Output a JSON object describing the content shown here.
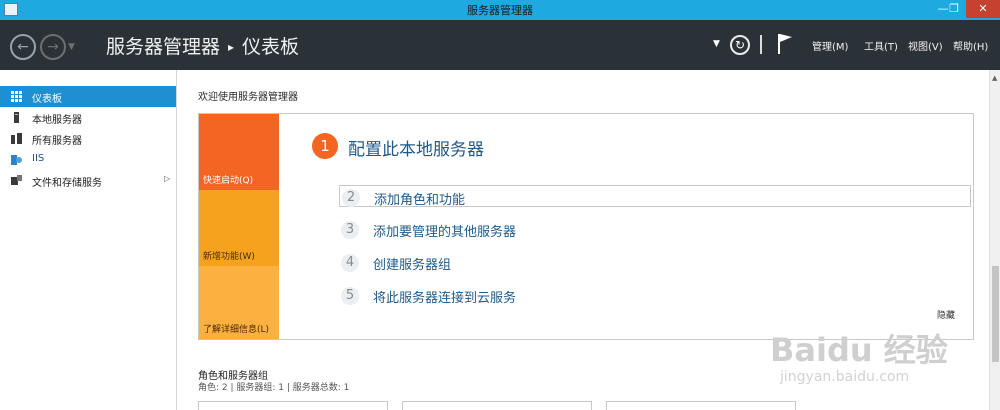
{
  "window": {
    "title": "服务器管理器",
    "controls": {
      "minimize": "—",
      "maximize": "❐",
      "close": "✕"
    }
  },
  "header": {
    "breadcrumb": [
      "服务器管理器",
      "仪表板"
    ],
    "separator": "▸",
    "menus": [
      "管理(M)",
      "工具(T)",
      "视图(V)",
      "帮助(H)"
    ]
  },
  "sidebar": {
    "items": [
      {
        "label": "仪表板",
        "icon": "dashboard-grid-icon",
        "active": true
      },
      {
        "label": "本地服务器",
        "icon": "server-icon"
      },
      {
        "label": "所有服务器",
        "icon": "servers-icon"
      },
      {
        "label": "IIS",
        "icon": "iis-icon"
      },
      {
        "label": "文件和存储服务",
        "icon": "file-storage-icon",
        "has_arrow": true
      }
    ]
  },
  "main": {
    "welcome": "欢迎使用服务器管理器",
    "tiles": [
      "快速启动(Q)",
      "新增功能(W)",
      "了解详细信息(L)"
    ],
    "primary_step": {
      "number": "1",
      "label": "配置此本地服务器"
    },
    "steps": [
      {
        "number": "2",
        "label": "添加角色和功能"
      },
      {
        "number": "3",
        "label": "添加要管理的其他服务器"
      },
      {
        "number": "4",
        "label": "创建服务器组"
      },
      {
        "number": "5",
        "label": "将此服务器连接到云服务"
      }
    ],
    "hide_label": "隐藏",
    "roles_title": "角色和服务器组",
    "roles_summary": "角色: 2 | 服务器组: 1 | 服务器总数: 1"
  },
  "watermark": {
    "brand": "Baidu 经验",
    "url": "jingyan.baidu.com"
  },
  "colors": {
    "titlebar": "#1ea9e1",
    "header": "#2b3237",
    "accent_orange": "#f26522",
    "tile_mid": "#f7a21e",
    "tile_light": "#fbb040",
    "sidebar_active": "#1e8fd0",
    "link_blue": "#1f5a8a"
  }
}
